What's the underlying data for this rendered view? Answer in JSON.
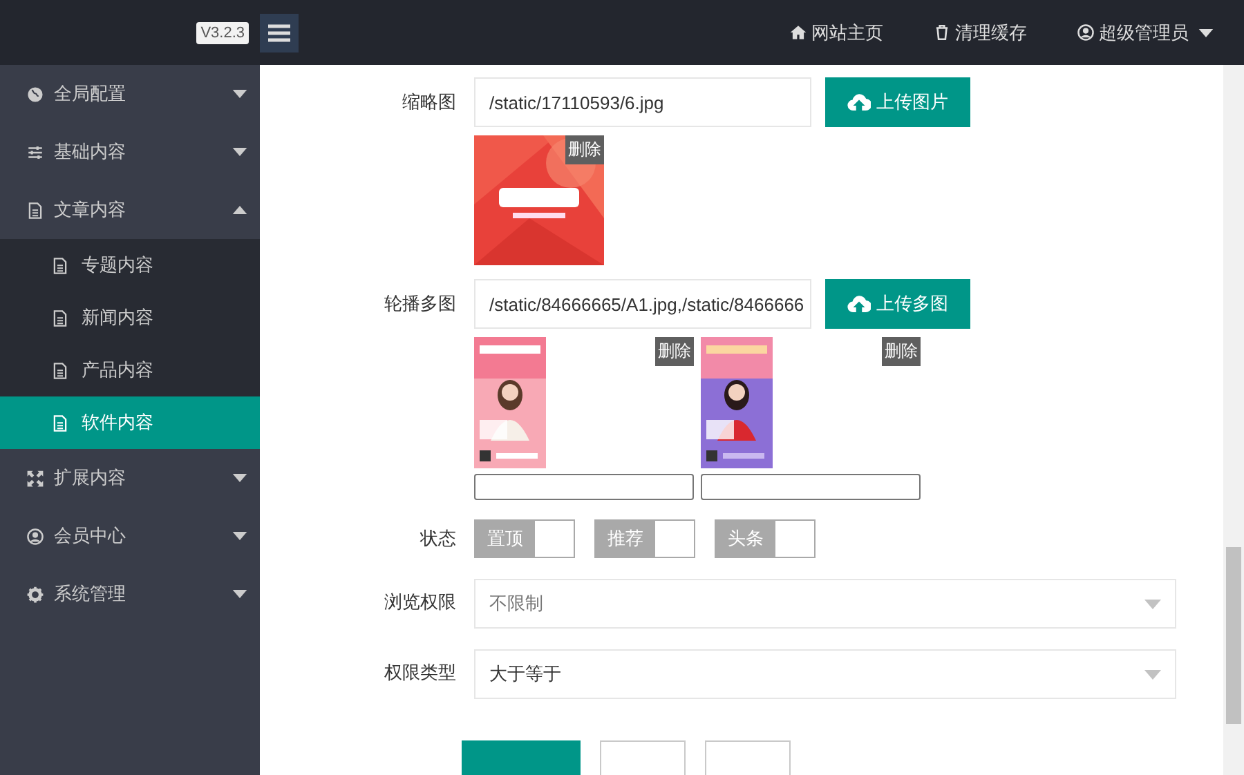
{
  "header": {
    "version": "V3.2.3",
    "links": [
      {
        "label": "网站主页",
        "dropdown": false
      },
      {
        "label": "清理缓存",
        "dropdown": false
      },
      {
        "label": "超级管理员",
        "dropdown": true
      }
    ]
  },
  "sidebar": {
    "items": [
      {
        "label": "全局配置",
        "expanded": false,
        "selected": false
      },
      {
        "label": "基础内容",
        "expanded": false,
        "selected": false
      },
      {
        "label": "文章内容",
        "expanded": true,
        "selected": false,
        "children": [
          {
            "label": "专题内容",
            "selected": false
          },
          {
            "label": "新闻内容",
            "selected": false
          },
          {
            "label": "产品内容",
            "selected": false
          },
          {
            "label": "软件内容",
            "selected": true
          }
        ]
      },
      {
        "label": "扩展内容",
        "expanded": false,
        "selected": false
      },
      {
        "label": "会员中心",
        "expanded": false,
        "selected": false
      },
      {
        "label": "系统管理",
        "expanded": false,
        "selected": false
      }
    ]
  },
  "form": {
    "rows": [
      {
        "kind": "upload",
        "label": "缩略图",
        "value": "/static/17110593/6.jpg",
        "button": "上传图片",
        "images": [
          {
            "kind": "picture",
            "delete": "删除"
          }
        ]
      },
      {
        "kind": "multi",
        "label": "轮播多图",
        "value": "/static/84666665/A1.jpg,/static/8466666",
        "button": "上传多图",
        "images": [
          {
            "kind": "picture",
            "delete": "删除"
          },
          {
            "kind": "picture",
            "delete": "删除"
          }
        ]
      },
      {
        "kind": "switches",
        "label": "状态",
        "switches": [
          {
            "label": "置顶",
            "on": false
          },
          {
            "label": "推荐",
            "on": false
          },
          {
            "label": "头条",
            "on": false
          }
        ]
      },
      {
        "kind": "select",
        "label": "浏览权限",
        "placeholder": "不限制"
      },
      {
        "kind": "select",
        "label": "权限类型",
        "value": "大于等于"
      }
    ],
    "buttons": [
      {
        "kind": "primary"
      },
      {
        "kind": "default"
      },
      {
        "kind": "default"
      }
    ]
  }
}
